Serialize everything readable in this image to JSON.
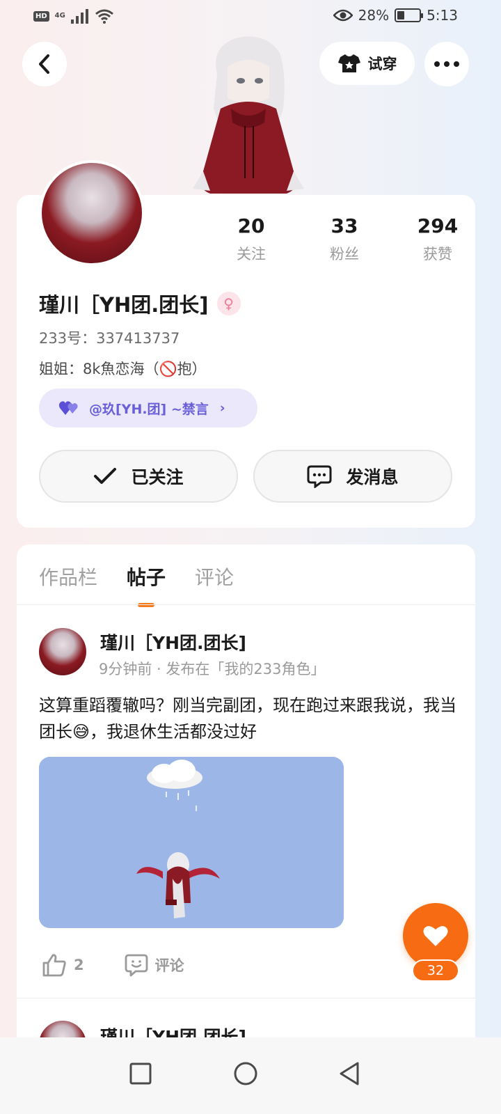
{
  "status_bar": {
    "hd": "HD",
    "network": "4G",
    "battery_percent": "28%",
    "time": "5:13"
  },
  "header": {
    "tryon_label": "试穿"
  },
  "profile": {
    "stats": [
      {
        "num": "20",
        "label": "关注"
      },
      {
        "num": "33",
        "label": "粉丝"
      },
      {
        "num": "294",
        "label": "获赞"
      }
    ],
    "name": "瑾川［YH团.团长]",
    "gender_symbol": "♀",
    "id_line": "233号：337413737",
    "bio": "姐姐：8k魚恋海（🚫抱）",
    "tag": {
      "text": "@玖[YH.团]    ~禁言",
      "chevron": "›"
    },
    "follow_label": "已关注",
    "message_label": "发消息"
  },
  "tabs": [
    {
      "label": "作品栏",
      "active": false
    },
    {
      "label": "帖子",
      "active": true
    },
    {
      "label": "评论",
      "active": false
    }
  ],
  "post": {
    "author": "瑾川［YH团.团长]",
    "meta": "9分钟前 · 发布在「我的233角色」",
    "text": "这算重蹈覆辙吗？刚当完副团，现在跑过来跟我说，我当团长😅，我退休生活都没过好",
    "likes": "2",
    "comment_label": "评论"
  },
  "next_post": {
    "author": "瑾川［YH团.团长]"
  },
  "fab": {
    "count": "32"
  },
  "colors": {
    "accent": "#f76c12",
    "tab_indicator": "#f47b20",
    "tag_bg": "#ebe8fb",
    "tag_text": "#6a5fd8"
  }
}
